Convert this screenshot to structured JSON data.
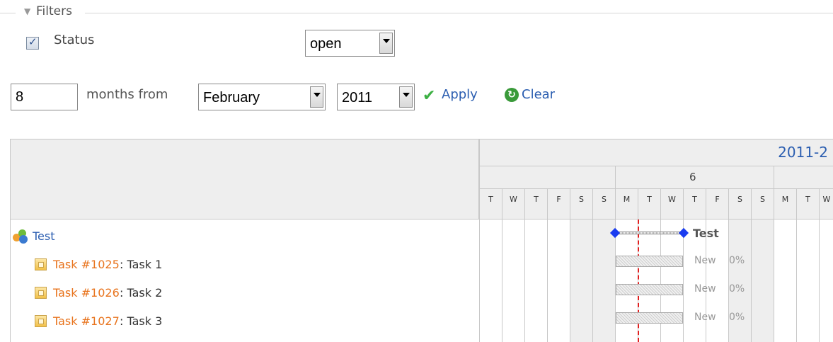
{
  "filters": {
    "legend": "Filters",
    "status": {
      "label": "Status",
      "checked": true,
      "operator": "open"
    }
  },
  "period": {
    "months": "8",
    "months_from_label": "months from",
    "month": "February",
    "year": "2011",
    "apply_label": "Apply",
    "clear_label": "Clear"
  },
  "gantt": {
    "month_header": "2011-2",
    "week_header": "6",
    "days": [
      "T",
      "W",
      "T",
      "F",
      "S",
      "S",
      "M",
      "T",
      "W",
      "T",
      "F",
      "S",
      "S",
      "M",
      "T",
      "W"
    ],
    "project": {
      "name": "Test",
      "bar_label": "Test"
    },
    "tasks": [
      {
        "link": "Task #1025",
        "subject": ": Task 1",
        "status": "New",
        "progress": "0%"
      },
      {
        "link": "Task #1026",
        "subject": ": Task 2",
        "status": "New",
        "progress": "0%"
      },
      {
        "link": "Task #1027",
        "subject": ": Task 3",
        "status": "New",
        "progress": "0%"
      }
    ]
  },
  "colors": {
    "link": "#2a5db0",
    "issue_link": "#e8741e",
    "milestone": "#1a3cf0",
    "today_marker": "#e02020"
  }
}
